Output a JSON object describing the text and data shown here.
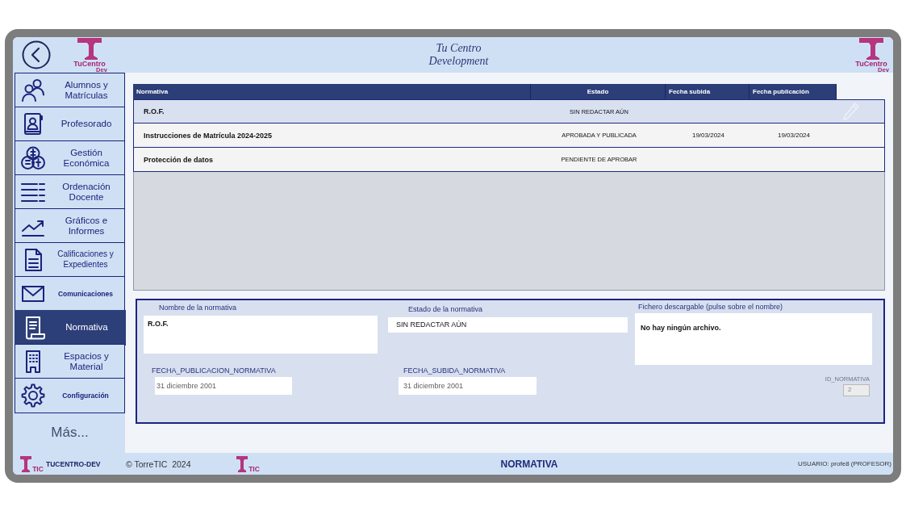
{
  "header": {
    "title_lines": [
      "Tu Centro",
      "Development"
    ],
    "left_logo": {
      "name": "TuCentro",
      "tag": "Dev"
    },
    "right_logo": {
      "name": "TuCentro",
      "tag": "Dev"
    }
  },
  "sidebar": {
    "items": [
      {
        "label": "Alumnos y Matrículas",
        "kind": "regular",
        "selected": false
      },
      {
        "label": "Profesorado",
        "kind": "regular",
        "selected": false
      },
      {
        "label": "Gestión Económica",
        "kind": "regular",
        "selected": false
      },
      {
        "label": "Ordenación Docente",
        "kind": "regular",
        "selected": false
      },
      {
        "label": "Gráficos e Informes",
        "kind": "regular",
        "selected": false
      },
      {
        "label": "Calificaciones y Expedientes",
        "kind": "small",
        "selected": false
      },
      {
        "label": "Comunicaciones",
        "kind": "compact",
        "selected": false
      },
      {
        "label": "Normativa",
        "kind": "regular",
        "selected": true
      },
      {
        "label": "Espacios y Material",
        "kind": "regular",
        "selected": false
      },
      {
        "label": "Configuración",
        "kind": "compact",
        "selected": false
      }
    ],
    "more": "Más..."
  },
  "table": {
    "columns": [
      "Normativa",
      "Estado",
      "Fecha subida",
      "Fecha publicación"
    ],
    "rows": [
      {
        "normativa": "R.O.F.",
        "estado": "SIN REDACTAR AÚN",
        "selected": true
      },
      {
        "normativa": "Instrucciones de Matrícula 2024-2025",
        "estado": "APROBADA Y PUBLICADA",
        "fecha_subida": "19/03/2024",
        "fecha_publicacion": "19/03/2024",
        "selected": false
      },
      {
        "normativa": "Protección de datos",
        "estado": "PENDIENTE DE APROBAR",
        "selected": false
      }
    ]
  },
  "form": {
    "name": {
      "label": "Nombre de la normativa",
      "value": "R.O.F."
    },
    "status": {
      "label": "Estado de la normativa",
      "value": "SIN REDACTAR AÚN"
    },
    "file": {
      "label": "Fichero descargable (pulse sobre el nombre)",
      "value": "No hay ningún archivo."
    },
    "publication_date": {
      "label": "FECHA_PUBLICACION_NORMATIVA",
      "value": "31 diciembre 2001"
    },
    "upload_date": {
      "label": "FECHA_SUBIDA_NORMATIVA",
      "value": "31 diciembre 2001"
    },
    "id": {
      "label": "ID_NORMATIVA",
      "value": "2",
      "disabled": true
    }
  },
  "footer": {
    "left_logo_text": "TIC",
    "app_name": "TUCENTRO-DEV",
    "copyright": "© TorreTIC  2024",
    "center_logo_text": "TIC",
    "screen_title": "NORMATIVA",
    "user": "USUARIO: profe8 (PROFESOR)"
  }
}
